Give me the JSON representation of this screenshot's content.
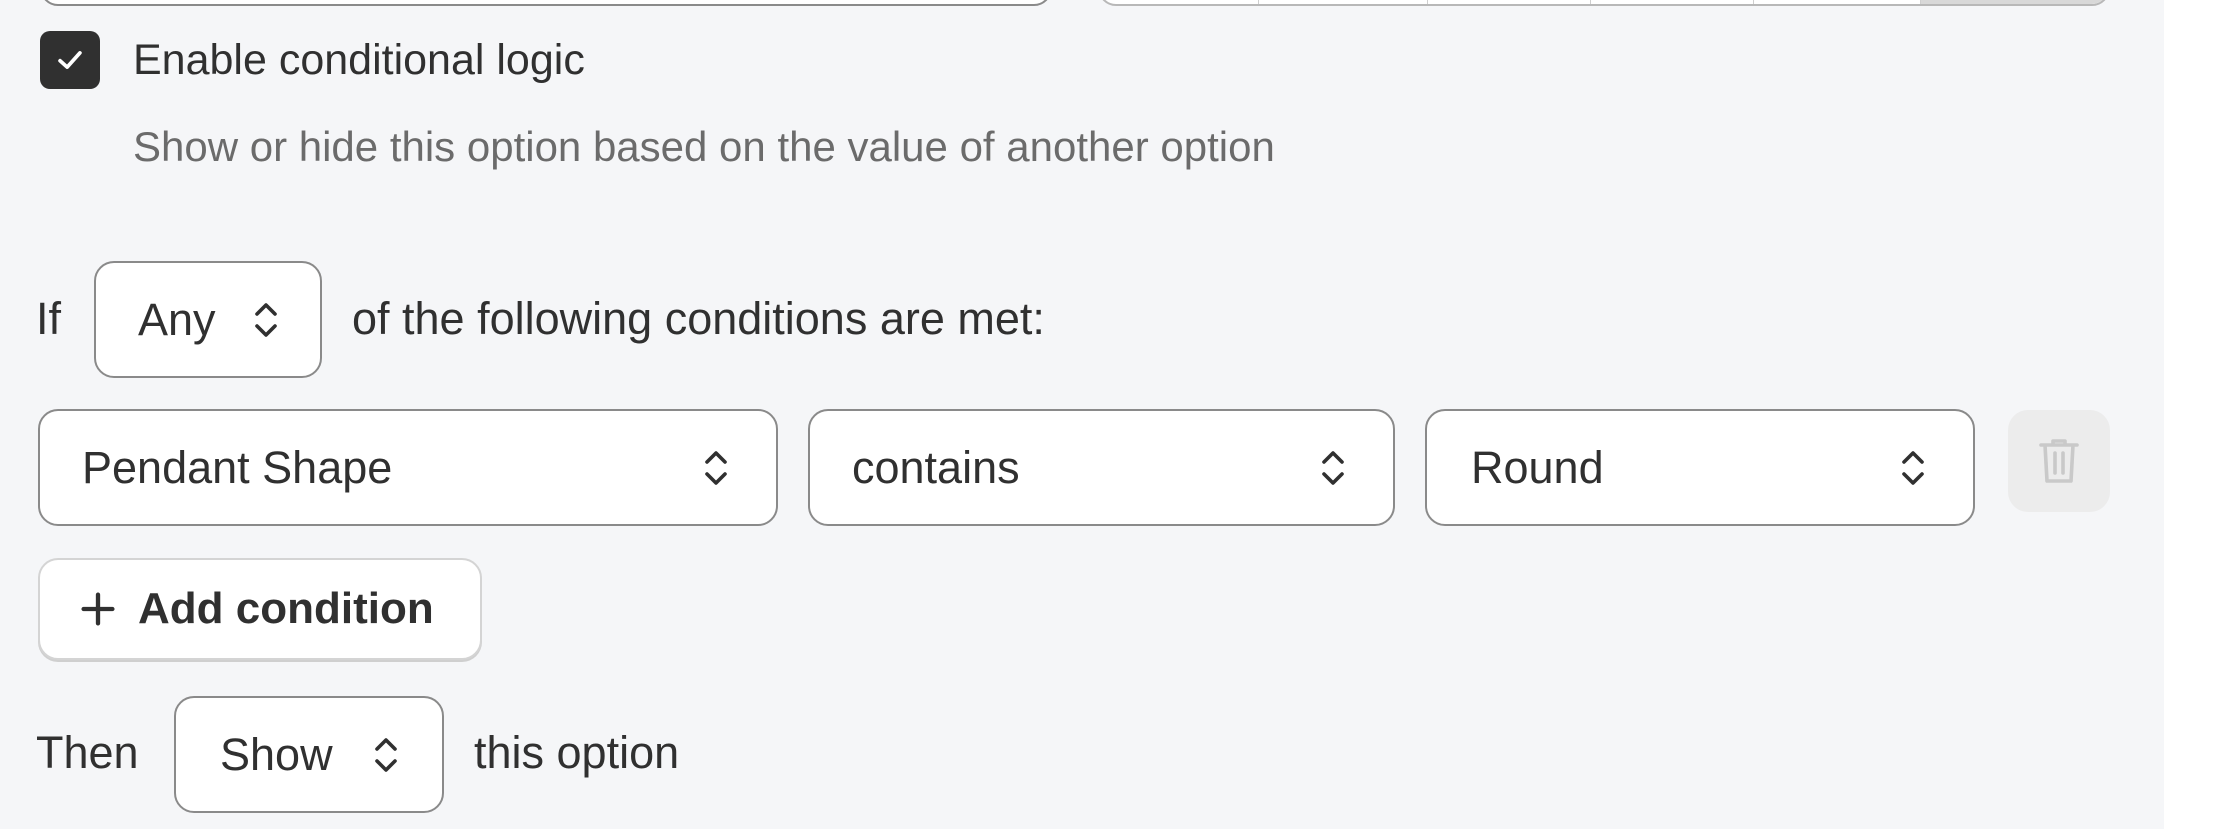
{
  "conditional_logic": {
    "enable_label": "Enable conditional logic",
    "enabled": true,
    "help_text": "Show or hide this option based on the value of another option"
  },
  "if_row": {
    "prefix": "If",
    "match_select": "Any",
    "suffix": "of the following conditions are met:"
  },
  "condition": {
    "field": "Pendant Shape",
    "operator": "contains",
    "value": "Round"
  },
  "add_condition_label": "Add condition",
  "then_row": {
    "prefix": "Then",
    "action_select": "Show",
    "suffix": "this option"
  },
  "colors": {
    "panel_bg": "#f5f6f8",
    "text": "#303030",
    "muted_text": "#6b6b6b",
    "border": "#8a8a8a",
    "checkbox_fill": "#303030"
  },
  "icons": {
    "checkbox": "check-icon",
    "select": "chevron-up-down-icon",
    "delete": "trash-icon",
    "add": "plus-icon"
  }
}
